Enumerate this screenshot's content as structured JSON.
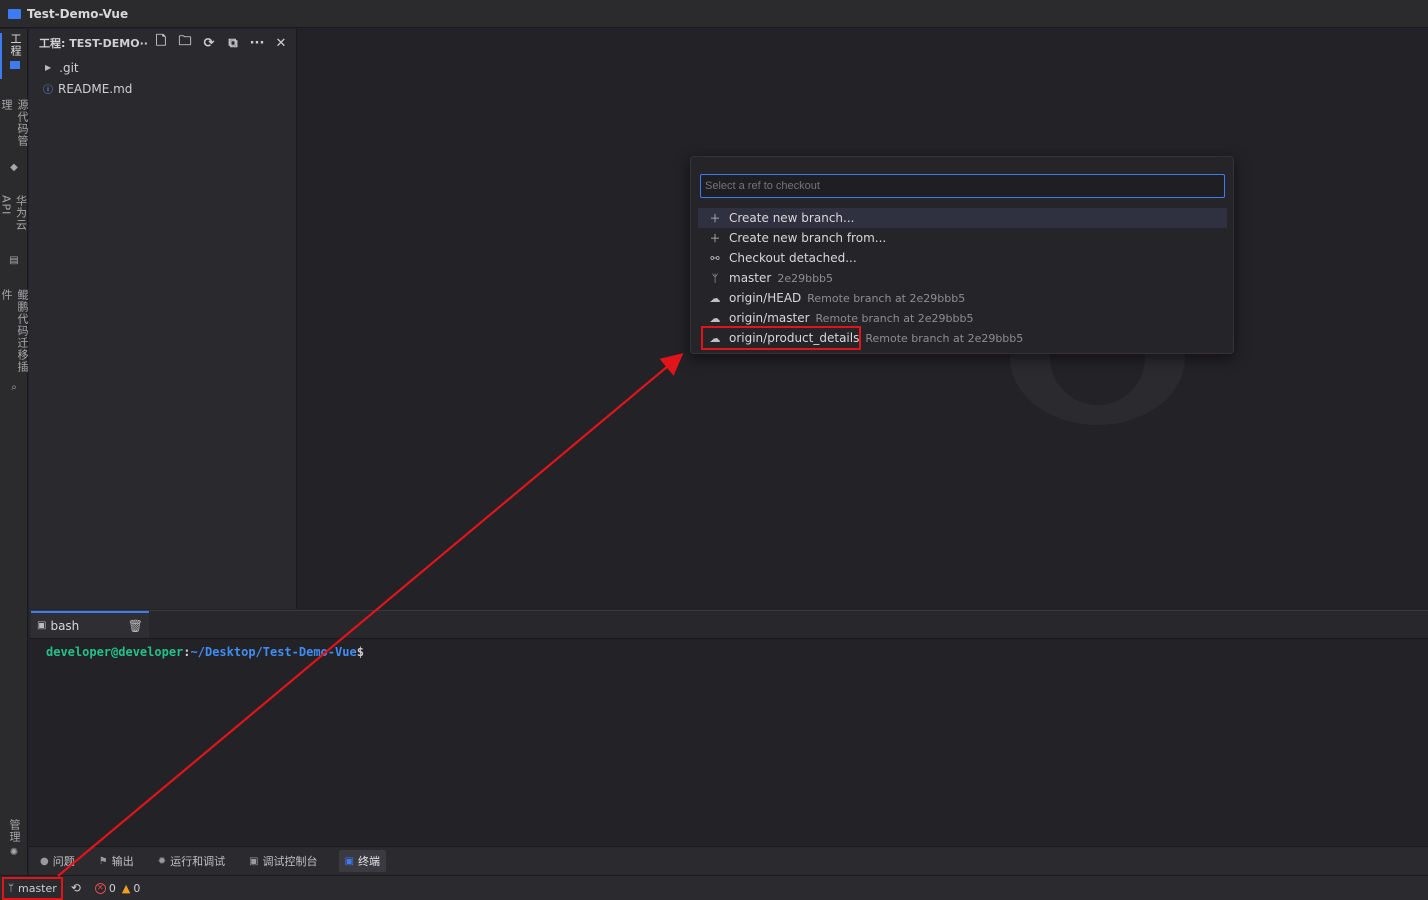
{
  "window": {
    "title": "Test-Demo-Vue"
  },
  "activity_bar": {
    "tabs": [
      {
        "label": "工程",
        "icon": "folder-icon",
        "active": true
      },
      {
        "label": "源代码管理",
        "icon": "git-icon",
        "active": false
      },
      {
        "label": "华为云 API",
        "icon": "api-icon",
        "active": false
      },
      {
        "label": "鲲鹏代码迁移插件",
        "icon": "migration-icon",
        "active": false
      },
      {
        "label": "管理",
        "icon": "gear-icon",
        "active": false
      }
    ]
  },
  "explorer": {
    "title": "工程: TEST-DEMO···",
    "toolbar": [
      "new-file-icon",
      "new-folder-icon",
      "refresh-icon",
      "collapse-icon",
      "more-icon",
      "close-icon"
    ],
    "items": [
      {
        "name": ".git",
        "type": "folder"
      },
      {
        "name": "README.md",
        "type": "file"
      }
    ]
  },
  "quick_pick": {
    "placeholder": "Select a ref to checkout",
    "items": [
      {
        "icon": "plus-icon",
        "label": "Create new branch...",
        "detail": "",
        "selected": true
      },
      {
        "icon": "plus-icon",
        "label": "Create new branch from...",
        "detail": "",
        "selected": false
      },
      {
        "icon": "detached-icon",
        "label": "Checkout detached...",
        "detail": "",
        "selected": false
      },
      {
        "icon": "branch-icon",
        "label": "master",
        "detail": "2e29bbb5",
        "selected": false
      },
      {
        "icon": "cloud-icon",
        "label": "origin/HEAD",
        "detail": "Remote branch at 2e29bbb5",
        "selected": false
      },
      {
        "icon": "cloud-icon",
        "label": "origin/master",
        "detail": "Remote branch at 2e29bbb5",
        "selected": false
      },
      {
        "icon": "cloud-icon",
        "label": "origin/product_details",
        "detail": "Remote branch at 2e29bbb5",
        "selected": false
      }
    ]
  },
  "terminal": {
    "tab_label": "bash",
    "prompt_user": "developer@developer",
    "prompt_sep": ":",
    "prompt_path": "~/Desktop/Test-Demo-Vue",
    "prompt_dollar": "$"
  },
  "bottom_tabs": [
    {
      "label": "问题",
      "icon": "problems-icon",
      "active": false
    },
    {
      "label": "输出",
      "icon": "output-icon",
      "active": false
    },
    {
      "label": "运行和调试",
      "icon": "debug-icon",
      "active": false
    },
    {
      "label": "调试控制台",
      "icon": "console-icon",
      "active": false
    },
    {
      "label": "终端",
      "icon": "terminal-icon",
      "active": true
    }
  ],
  "status_bar": {
    "branch": "master",
    "errors": "0",
    "warnings": "0"
  },
  "colors": {
    "accent": "#3d7bf2",
    "annotation_red": "#e1141a",
    "terminal_user": "#23c28a",
    "terminal_path": "#3f8ef5"
  }
}
